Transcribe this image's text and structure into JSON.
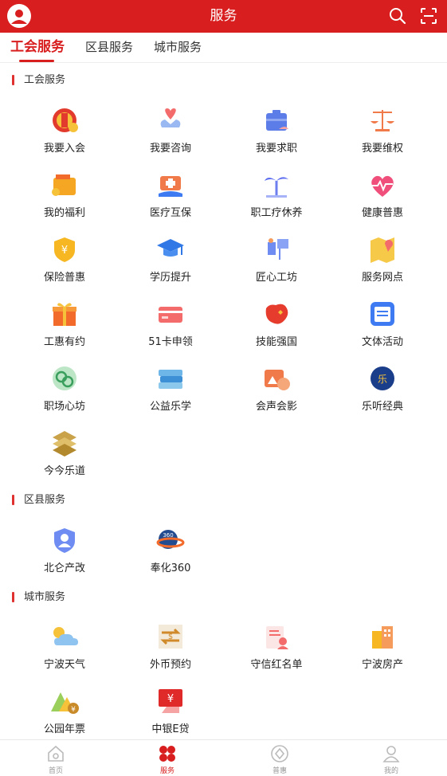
{
  "header": {
    "title": "服务",
    "avatar_icon": "user-avatar-icon",
    "search_icon": "search-icon",
    "scan_icon": "scan-icon",
    "color": "#d81e1e"
  },
  "tabs": [
    {
      "label": "工会服务",
      "active": true
    },
    {
      "label": "区县服务",
      "active": false
    },
    {
      "label": "城市服务",
      "active": false
    }
  ],
  "sections": {
    "union": {
      "title": "工会服务",
      "items": [
        {
          "label": "我要入会",
          "icon": "union-emblem-icon"
        },
        {
          "label": "我要咨询",
          "icon": "heart-hands-icon"
        },
        {
          "label": "我要求职",
          "icon": "briefcase-icon"
        },
        {
          "label": "我要维权",
          "icon": "scales-icon"
        },
        {
          "label": "我的福利",
          "icon": "wallet-icon"
        },
        {
          "label": "医疗互保",
          "icon": "medical-kit-icon"
        },
        {
          "label": "职工疗休养",
          "icon": "palm-tree-icon"
        },
        {
          "label": "健康普惠",
          "icon": "heart-pulse-icon"
        },
        {
          "label": "保险普惠",
          "icon": "shield-yen-icon"
        },
        {
          "label": "学历提升",
          "icon": "graduation-cap-icon"
        },
        {
          "label": "匠心工坊",
          "icon": "workshop-icon"
        },
        {
          "label": "服务网点",
          "icon": "map-pin-icon"
        },
        {
          "label": "工惠有约",
          "icon": "gift-icon"
        },
        {
          "label": "51卡申领",
          "icon": "card-icon"
        },
        {
          "label": "技能强国",
          "icon": "china-map-icon"
        },
        {
          "label": "文体活动",
          "icon": "calendar-icon"
        },
        {
          "label": "职场心坊",
          "icon": "mind-icon"
        },
        {
          "label": "公益乐学",
          "icon": "books-icon"
        },
        {
          "label": "会声会影",
          "icon": "media-icon"
        },
        {
          "label": "乐听经典",
          "icon": "audio-icon"
        },
        {
          "label": "今今乐道",
          "icon": "logo-stack-icon"
        }
      ]
    },
    "district": {
      "title": "区县服务",
      "items": [
        {
          "label": "北仑产改",
          "icon": "shield-user-icon"
        },
        {
          "label": "奉化360",
          "icon": "globe-360-icon"
        }
      ]
    },
    "city": {
      "title": "城市服务",
      "items": [
        {
          "label": "宁波天气",
          "icon": "weather-icon"
        },
        {
          "label": "外币预约",
          "icon": "currency-exchange-icon"
        },
        {
          "label": "守信红名单",
          "icon": "redlist-icon"
        },
        {
          "label": "宁波房产",
          "icon": "building-icon"
        },
        {
          "label": "公园年票",
          "icon": "park-ticket-icon"
        },
        {
          "label": "中银E贷",
          "icon": "loan-icon"
        }
      ]
    }
  },
  "bottom_nav": [
    {
      "label": "首页",
      "icon": "home-icon",
      "active": false
    },
    {
      "label": "服务",
      "icon": "service-grid-icon",
      "active": true
    },
    {
      "label": "普惠",
      "icon": "diamond-icon",
      "active": false
    },
    {
      "label": "我的",
      "icon": "profile-icon",
      "active": false
    }
  ]
}
